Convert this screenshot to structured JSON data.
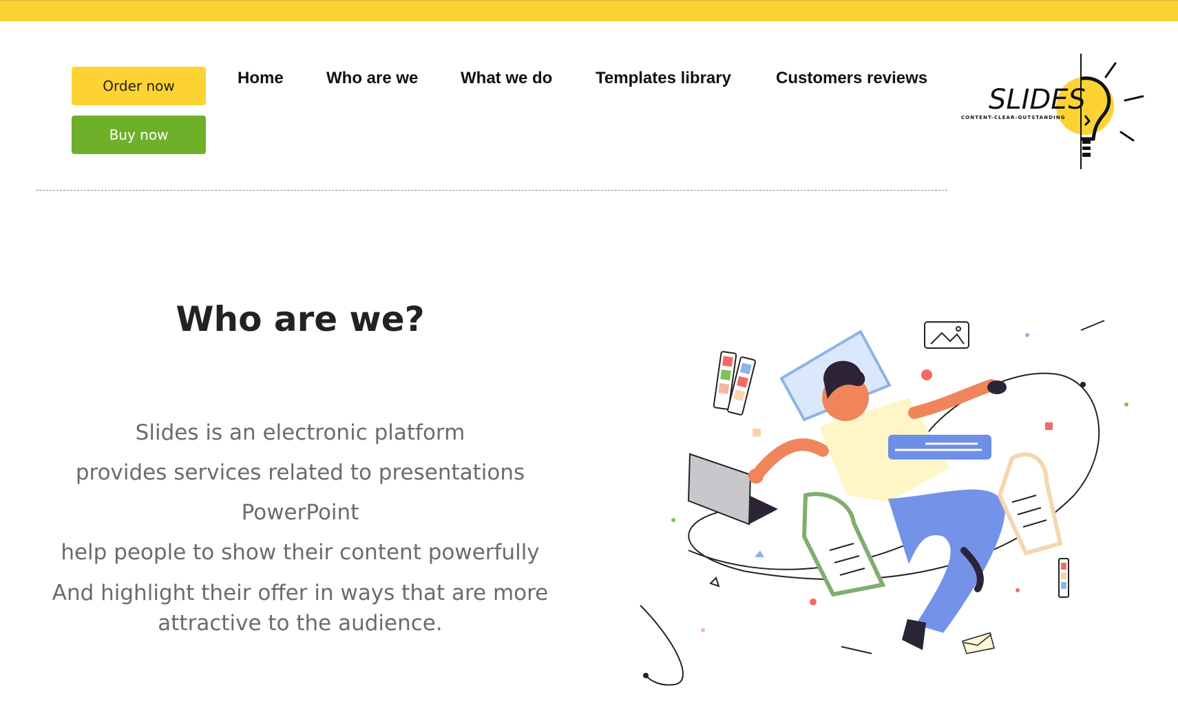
{
  "header": {
    "order_label": "Order now",
    "buy_label": "Buy now",
    "nav": [
      "Home",
      "Who are we",
      "What we do",
      "Templates library",
      "Customers reviews"
    ],
    "logo": {
      "text": "SLIDES",
      "tagline": "CONTENT-CLEAR-OUTSTANDING"
    }
  },
  "section": {
    "title": "Who are we?",
    "lines": [
      "Slides is an electronic platform",
      "provides services related to presentations",
      "PowerPoint",
      "help people to show their content powerfully",
      "And highlight their offer in ways that are more",
      "attractive to the audience."
    ]
  },
  "colors": {
    "accent_yellow": "#FDD334",
    "accent_green": "#6FB02A",
    "text_gray": "#6b6b6b"
  },
  "illustration": {
    "icon": "person-working-illustration"
  }
}
